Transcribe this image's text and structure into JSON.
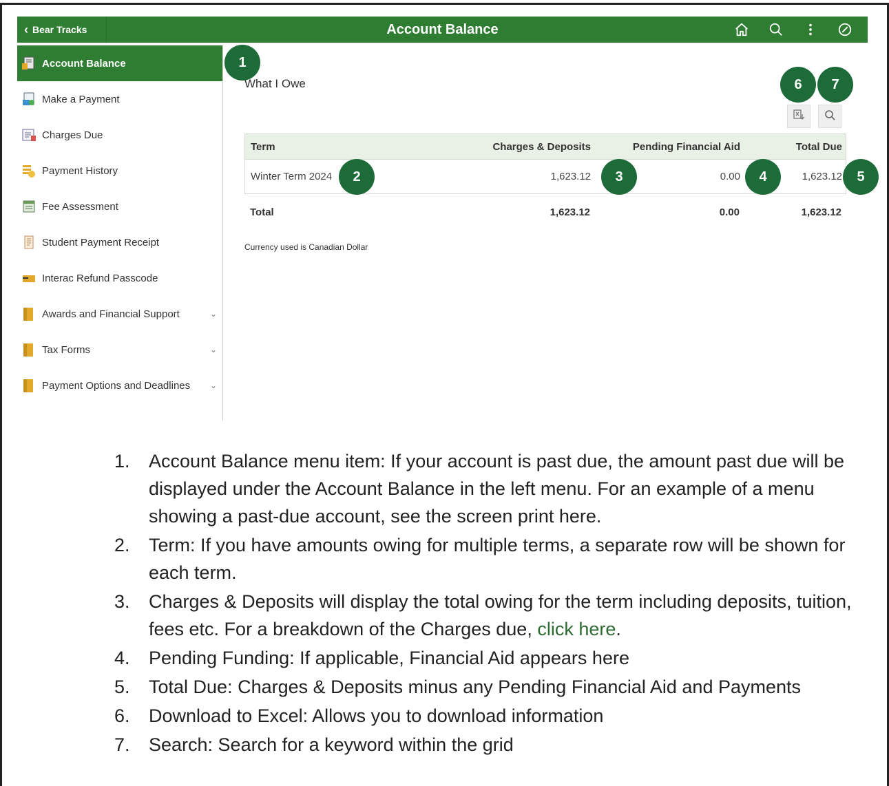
{
  "header": {
    "back_label": "Bear Tracks",
    "title": "Account Balance",
    "icons": [
      "home-icon",
      "search-icon",
      "more-vertical-icon",
      "compass-icon"
    ]
  },
  "sidebar": {
    "items": [
      {
        "label": "Account Balance",
        "icon": "account-balance-icon",
        "active": true
      },
      {
        "label": "Make a Payment",
        "icon": "make-payment-icon"
      },
      {
        "label": "Charges Due",
        "icon": "charges-due-icon"
      },
      {
        "label": "Payment History",
        "icon": "payment-history-icon"
      },
      {
        "label": "Fee Assessment",
        "icon": "fee-assessment-icon"
      },
      {
        "label": "Student Payment Receipt",
        "icon": "receipt-icon"
      },
      {
        "label": "Interac Refund Passcode",
        "icon": "passcode-icon"
      },
      {
        "label": "Awards and Financial Support",
        "icon": "folder-icon",
        "expandable": true
      },
      {
        "label": "Tax Forms",
        "icon": "folder-icon",
        "expandable": true
      },
      {
        "label": "Payment Options and Deadlines",
        "icon": "folder-icon",
        "expandable": true
      }
    ]
  },
  "main": {
    "section_title": "What I Owe",
    "table": {
      "headers": [
        "Term",
        "Charges & Deposits",
        "Pending Financial Aid",
        "Total Due"
      ],
      "rows": [
        [
          "Winter Term 2024",
          "1,623.12",
          "0.00",
          "1,623.12"
        ]
      ],
      "total": [
        "Total",
        "1,623.12",
        "0.00",
        "1,623.12"
      ]
    },
    "currency_note": "Currency used is Canadian Dollar",
    "tools": [
      "download-excel-icon",
      "search-icon"
    ]
  },
  "badges": [
    "1",
    "2",
    "3",
    "4",
    "5",
    "6",
    "7"
  ],
  "notes": [
    {
      "num": "1.",
      "text": "Account Balance menu item: If your account is past due, the amount past due will be displayed under the Account Balance in the left menu.  For an example of a menu showing a past-due account, see the screen print here."
    },
    {
      "num": "2.",
      "text": "Term: If you have amounts owing for multiple terms, a separate row will be shown for each term."
    },
    {
      "num": "3.",
      "text": "Charges & Deposits will display the total owing for the term including deposits, tuition, fees etc. For a breakdown of the Charges due, ",
      "link": "click here",
      "after": "."
    },
    {
      "num": "4.",
      "text": "Pending Funding: If applicable, Financial Aid appears here"
    },
    {
      "num": "5.",
      "text": "Total Due: Charges & Deposits minus any Pending Financial Aid and Payments"
    },
    {
      "num": "6.",
      "text": "Download to Excel: Allows you to download information"
    },
    {
      "num": "7.",
      "text": "Search: Search for a keyword within the grid"
    }
  ]
}
